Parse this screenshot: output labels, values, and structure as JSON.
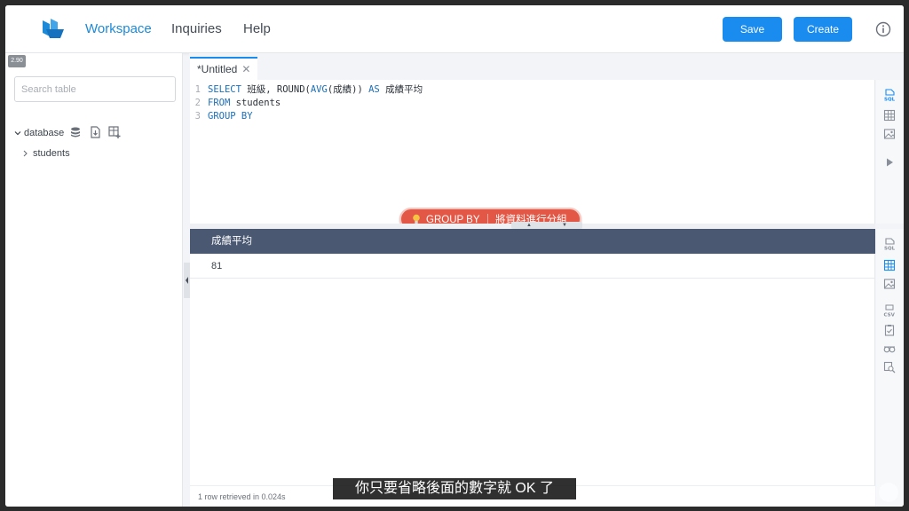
{
  "header": {
    "nav": [
      "Workspace",
      "Inquiries",
      "Help"
    ],
    "active_nav": "Workspace",
    "save_label": "Save",
    "create_label": "Create",
    "accent_color": "#1a8cf0"
  },
  "sidebar": {
    "version_badge": "2.90",
    "search_placeholder": "Search table",
    "database_label": "database",
    "tables": [
      "students"
    ]
  },
  "editor": {
    "tab_label": "*Untitled",
    "lines": [
      {
        "num": "1",
        "segments": [
          {
            "t": "SELECT ",
            "kw": true
          },
          {
            "t": "班級, ROUND(",
            "kw": false
          },
          {
            "t": "AVG",
            "kw": true
          },
          {
            "t": "(成績)) ",
            "kw": false
          },
          {
            "t": "AS",
            "kw": true
          },
          {
            "t": " 成績平均",
            "kw": false
          }
        ]
      },
      {
        "num": "2",
        "segments": [
          {
            "t": "FROM",
            "kw": true
          },
          {
            "t": " students",
            "kw": false
          }
        ]
      },
      {
        "num": "3",
        "segments": [
          {
            "t": "GROUP BY",
            "kw": true
          }
        ]
      }
    ],
    "hint_text": "GROUP BY ｜ 將資料進行分組",
    "hint_color": "#e25745"
  },
  "results": {
    "columns": [
      "成績平均"
    ],
    "rows": [
      [
        "81"
      ]
    ],
    "status": "1 row retrieved in 0.024s"
  },
  "subtitle": "你只要省略後面的數字就 OK 了",
  "icons": {
    "top_rail": [
      "sql-icon",
      "table-icon",
      "image-icon",
      "play-icon"
    ],
    "bottom_rail": [
      "sql-icon",
      "table-icon",
      "image-icon",
      "csv-icon",
      "clipboard-check-icon",
      "glasses-icon",
      "zoom-doc-icon"
    ]
  }
}
